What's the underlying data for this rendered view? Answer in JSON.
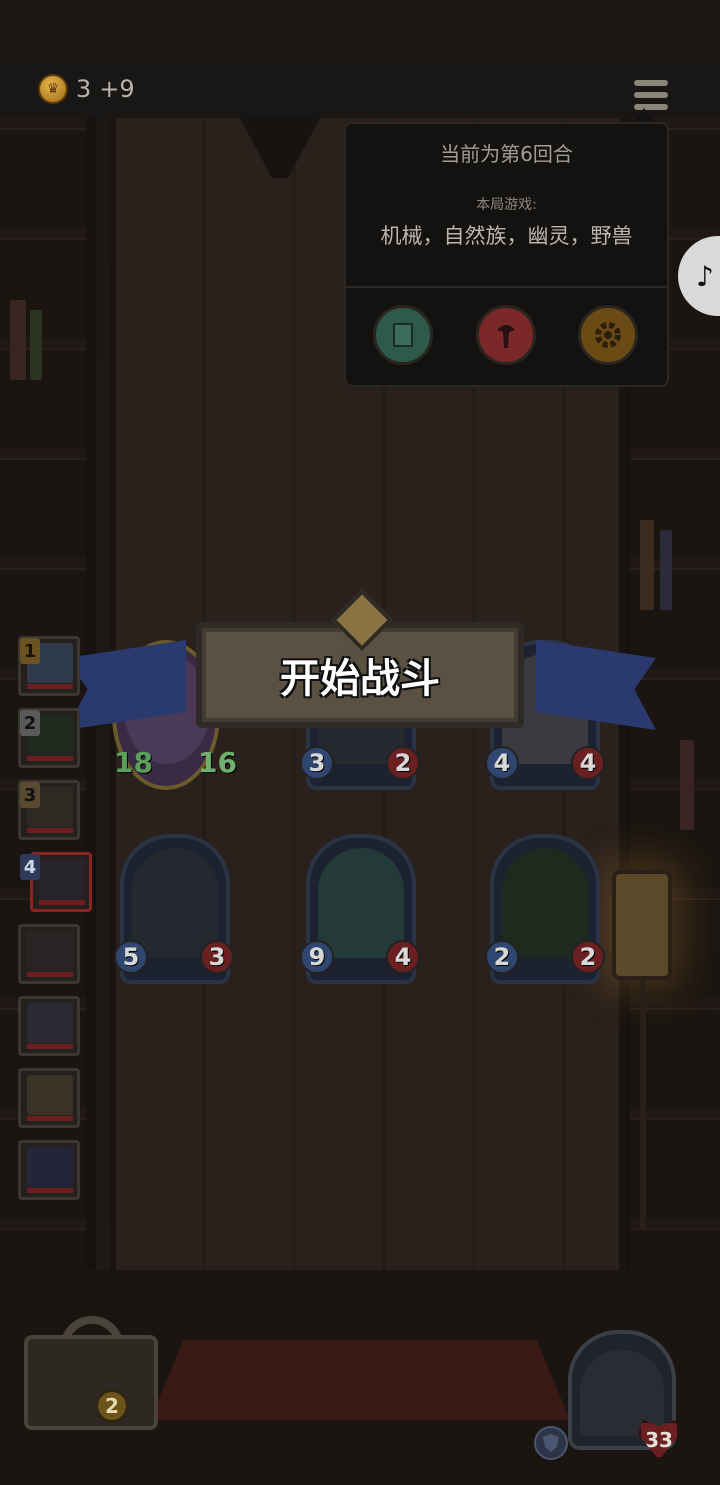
{
  "status_bar": {
    "gold": "3",
    "gold_income": "+9"
  },
  "menu": {
    "icon": "hamburger-menu-icon"
  },
  "info_popup": {
    "round_text": "当前为第6回合",
    "game_label": "本局游戏:",
    "tribes_text": "机械，自然族，幽灵，野兽",
    "buttons": [
      {
        "name": "codex-book-button",
        "icon": "book-icon",
        "color": "#2d5a4a"
      },
      {
        "name": "hero-axe-button",
        "icon": "axe-icon",
        "color": "#7a2828"
      },
      {
        "name": "settings-button",
        "icon": "gear-icon",
        "color": "#6b4b14"
      }
    ]
  },
  "start_battle": {
    "label": "开始战斗"
  },
  "hero_row": [
    {
      "attack": "18",
      "health": "16"
    },
    {
      "attack": "3",
      "health": "2"
    },
    {
      "attack": "4",
      "health": "4"
    }
  ],
  "board_row": [
    {
      "attack": "5",
      "health": "3"
    },
    {
      "attack": "9",
      "health": "4"
    },
    {
      "attack": "2",
      "health": "2"
    }
  ],
  "player_ranks": [
    "1",
    "2",
    "3",
    "4"
  ],
  "bottom": {
    "lock_coins": "2",
    "hero_health": "33"
  },
  "colors": {
    "accent_blue": "#2f4770",
    "accent_red": "#6a2020",
    "gold": "#e9b64a"
  }
}
